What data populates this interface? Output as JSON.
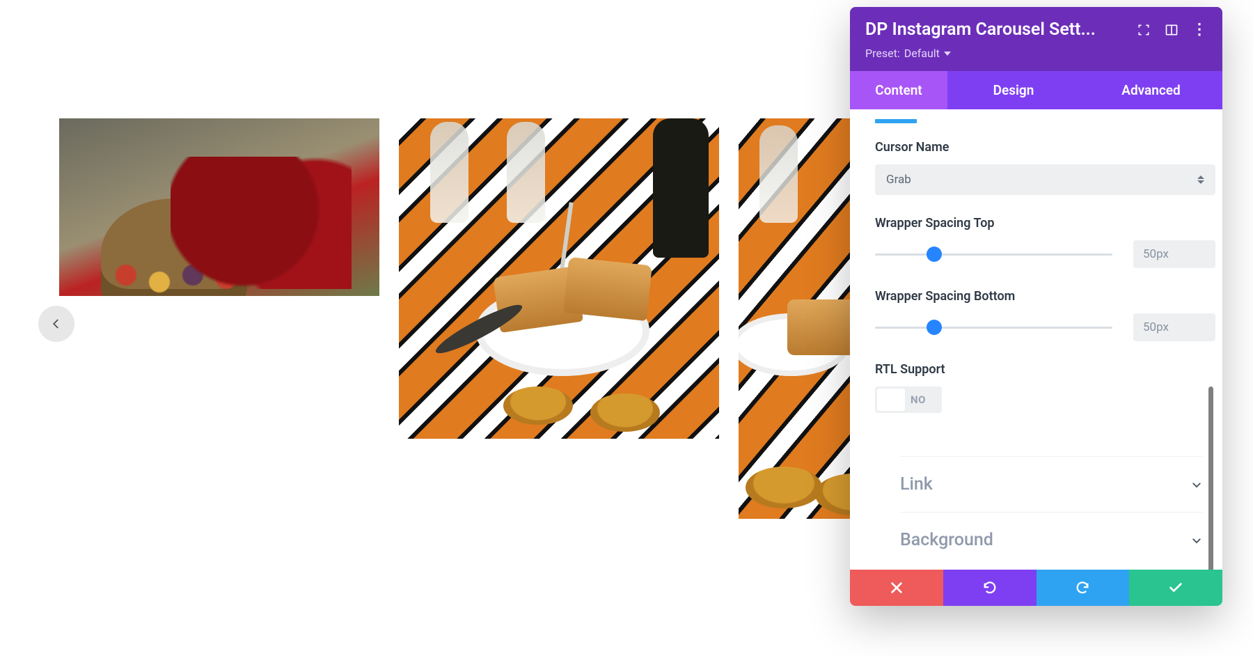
{
  "panel": {
    "title": "DP Instagram Carousel Sett...",
    "preset_prefix": "Preset:",
    "preset_value": "Default"
  },
  "tabs": {
    "content": "Content",
    "design": "Design",
    "advanced": "Advanced",
    "active": "content"
  },
  "fields": {
    "cursor_name": {
      "label": "Cursor Name",
      "value": "Grab"
    },
    "wrapper_top": {
      "label": "Wrapper Spacing Top",
      "value": "50px",
      "percent": 25
    },
    "wrapper_bottom": {
      "label": "Wrapper Spacing Bottom",
      "value": "50px",
      "percent": 25
    },
    "rtl": {
      "label": "RTL Support",
      "value": false,
      "off_label": "NO"
    }
  },
  "accordions": {
    "link": "Link",
    "background": "Background"
  }
}
